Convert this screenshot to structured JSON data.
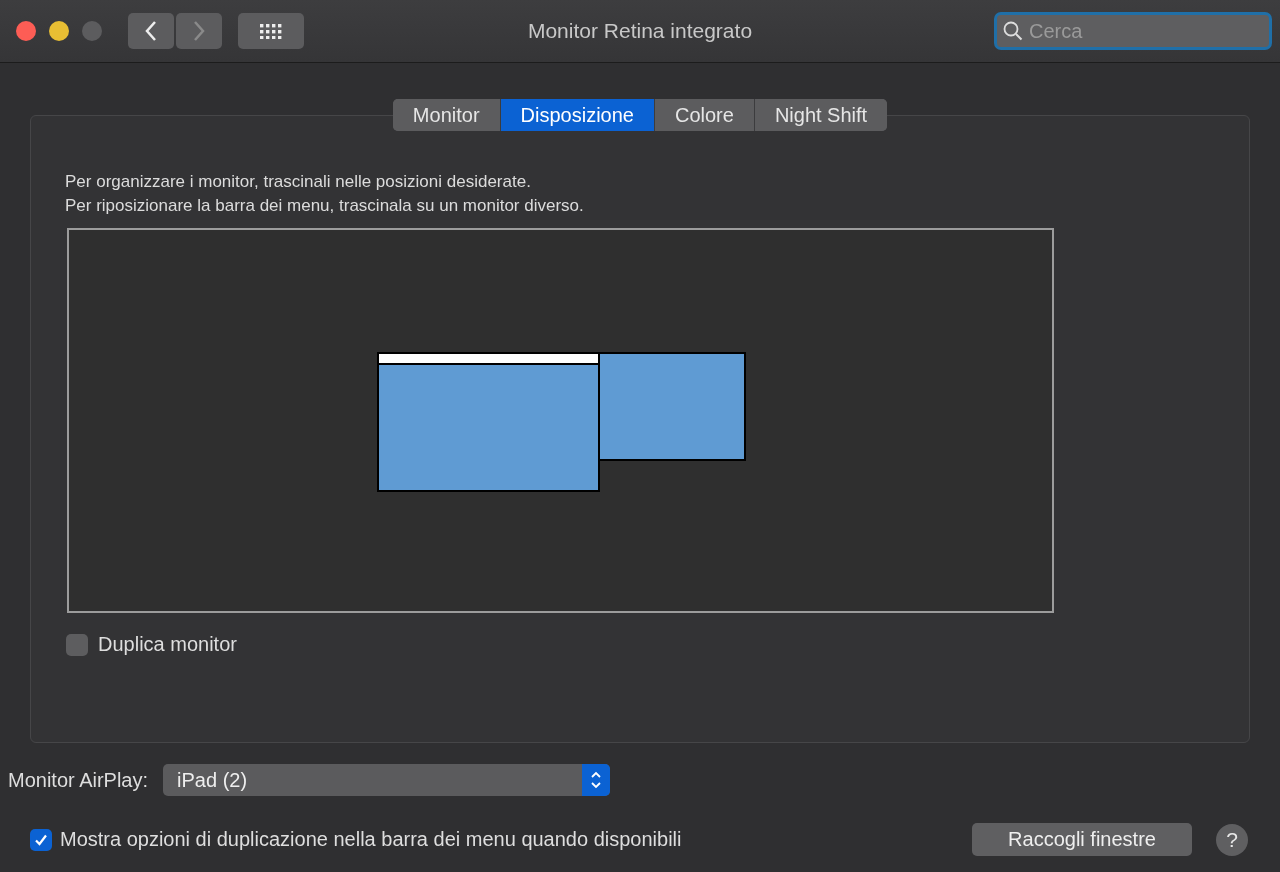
{
  "window": {
    "title": "Monitor Retina integrato"
  },
  "search": {
    "placeholder": "Cerca"
  },
  "tabs": [
    {
      "label": "Monitor",
      "selected": false
    },
    {
      "label": "Disposizione",
      "selected": true
    },
    {
      "label": "Colore",
      "selected": false
    },
    {
      "label": "Night Shift",
      "selected": false
    }
  ],
  "instructions": [
    "Per organizzare i monitor, trascinali nelle posizioni desiderate.",
    "Per riposizionare la barra dei menu, trascinala su un monitor diverso."
  ],
  "displays": [
    {
      "menu_bar": true
    },
    {
      "menu_bar": false
    }
  ],
  "mirror": {
    "label": "Duplica monitor",
    "checked": false
  },
  "airplay": {
    "label": "Monitor AirPlay:",
    "value": "iPad (2)"
  },
  "show_options": {
    "label": "Mostra opzioni di duplicazione nella barra dei menu quando disponibili",
    "checked": true
  },
  "gather_button": "Raccogli finestre",
  "help": "?"
}
